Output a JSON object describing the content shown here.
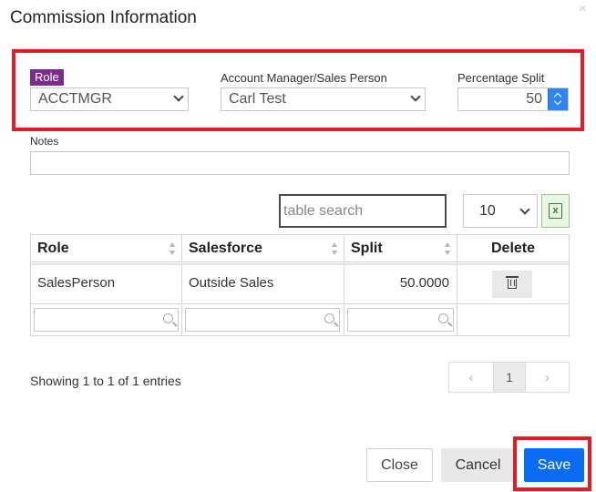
{
  "dialog": {
    "title": "Commission Information",
    "close_glyph": "×"
  },
  "form": {
    "role_label": "Role",
    "role_value": "ACCTMGR",
    "manager_label": "Account Manager/Sales Person",
    "manager_value": "Carl Test",
    "split_label": "Percentage Split",
    "split_value": "50",
    "notes_label": "Notes",
    "notes_value": ""
  },
  "toolbar": {
    "search_placeholder": "table search",
    "page_length": "10",
    "excel_icon": "excel-export-icon",
    "excel_glyph": "x"
  },
  "table": {
    "headers": {
      "role": "Role",
      "salesforce": "Salesforce",
      "split": "Split",
      "delete": "Delete"
    },
    "rows": [
      {
        "role": "SalesPerson",
        "salesforce": "Outside Sales",
        "split": "50.0000"
      }
    ]
  },
  "footer": {
    "info": "Showing 1 to 1 of 1 entries",
    "prev": "‹",
    "page": "1",
    "next": "›"
  },
  "buttons": {
    "close": "Close",
    "cancel": "Cancel",
    "save": "Save"
  },
  "colors": {
    "highlight": "#e31b23",
    "role_badge": "#7b2d8e",
    "primary": "#0a6cf2",
    "spinner": "#2f85f2"
  }
}
